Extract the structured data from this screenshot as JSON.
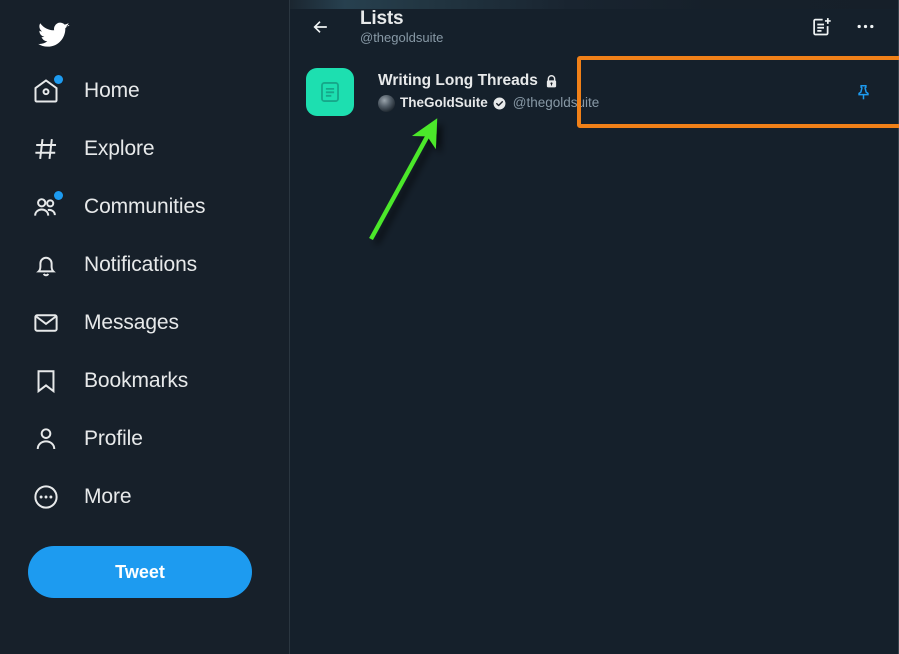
{
  "sidebar": {
    "logo": "twitter-bird-logo",
    "items": [
      {
        "label": "Home",
        "icon": "home-icon",
        "badge": true
      },
      {
        "label": "Explore",
        "icon": "hashtag-icon",
        "badge": false
      },
      {
        "label": "Communities",
        "icon": "communities-icon",
        "badge": true
      },
      {
        "label": "Notifications",
        "icon": "bell-icon",
        "badge": false
      },
      {
        "label": "Messages",
        "icon": "envelope-icon",
        "badge": false
      },
      {
        "label": "Bookmarks",
        "icon": "bookmark-icon",
        "badge": false
      },
      {
        "label": "Profile",
        "icon": "person-icon",
        "badge": false
      },
      {
        "label": "More",
        "icon": "more-circle-icon",
        "badge": false
      }
    ],
    "tweet_button": "Tweet"
  },
  "header": {
    "back_icon": "back-arrow-icon",
    "title": "Lists",
    "subtitle": "@thegoldsuite",
    "create_list_icon": "create-list-icon",
    "more_icon": "more-ellipsis-icon"
  },
  "lists": [
    {
      "thumbnail_icon": "list-document-icon",
      "thumbnail_color": "#1ddfb0",
      "name": "Writing Long Threads",
      "private": true,
      "lock_icon": "lock-icon",
      "owner_name": "TheGoldSuite",
      "owner_verified": true,
      "verified_icon": "verified-badge-icon",
      "owner_handle": "@thegoldsuite",
      "pinned": true,
      "pin_icon": "pin-icon"
    }
  ],
  "annotations": {
    "highlight_color": "#f08018",
    "arrow_color": "#4ce82a"
  },
  "colors": {
    "accent": "#1d9bf0",
    "background": "#15202b",
    "sidebar_background": "#17202a",
    "text_primary": "#e7e9ea",
    "text_secondary": "#8899a6"
  }
}
